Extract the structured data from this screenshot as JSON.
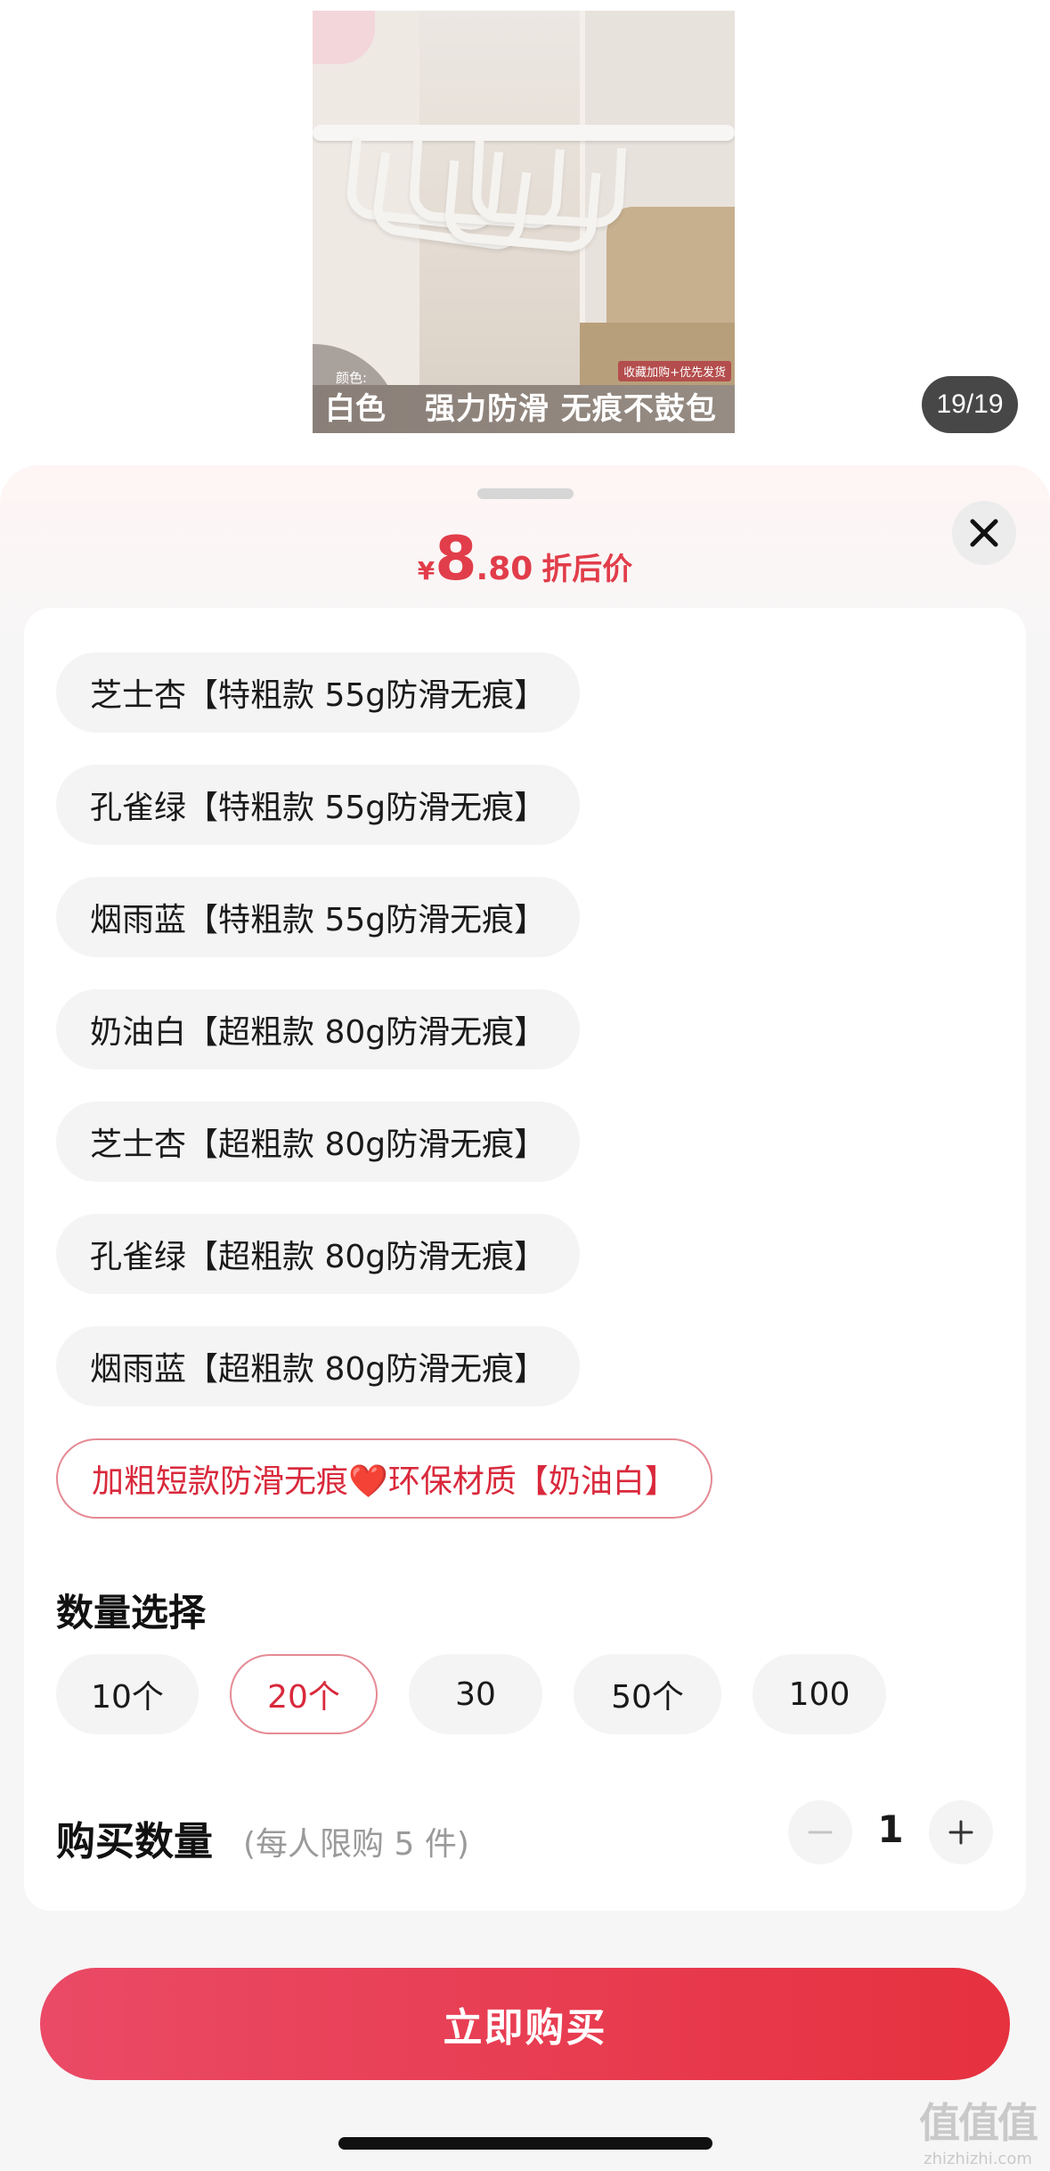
{
  "product_image": {
    "color_label": "颜色:",
    "color_name": "白色",
    "slogan": "强力防滑 无痕不鼓包",
    "promo_tag": "收藏加购+优先发货"
  },
  "page_counter": "19/19",
  "price": {
    "currency": "¥",
    "integer": "8",
    "decimal": ".80",
    "label": "折后价"
  },
  "specs": [
    {
      "label": "芝士杏【特粗款 55g防滑无痕】",
      "selected": false
    },
    {
      "label": "孔雀绿【特粗款 55g防滑无痕】",
      "selected": false
    },
    {
      "label": "烟雨蓝【特粗款 55g防滑无痕】",
      "selected": false
    },
    {
      "label": "奶油白【超粗款 80g防滑无痕】",
      "selected": false
    },
    {
      "label": "芝士杏【超粗款 80g防滑无痕】",
      "selected": false
    },
    {
      "label": "孔雀绿【超粗款 80g防滑无痕】",
      "selected": false
    },
    {
      "label": "烟雨蓝【超粗款 80g防滑无痕】",
      "selected": false
    },
    {
      "label": "加粗短款防滑无痕❤️环保材质【奶油白】",
      "selected": true
    }
  ],
  "quantity_section": {
    "title": "数量选择",
    "options": [
      {
        "label": "10个",
        "selected": false
      },
      {
        "label": "20个",
        "selected": true
      },
      {
        "label": "30",
        "selected": false
      },
      {
        "label": "50个",
        "selected": false
      },
      {
        "label": "100",
        "selected": false
      }
    ]
  },
  "purchase": {
    "title": "购买数量",
    "limit": "(每人限购 5 件)",
    "value": "1"
  },
  "buy_button": "立即购买",
  "watermark": {
    "logo": "值值值",
    "url": "zhizhizhi.com"
  },
  "colors": {
    "accent": "#e23d4a",
    "selected_border": "#e58a94",
    "chip_bg": "#f4f4f4",
    "sheet_bg": "#f6f6f6"
  }
}
